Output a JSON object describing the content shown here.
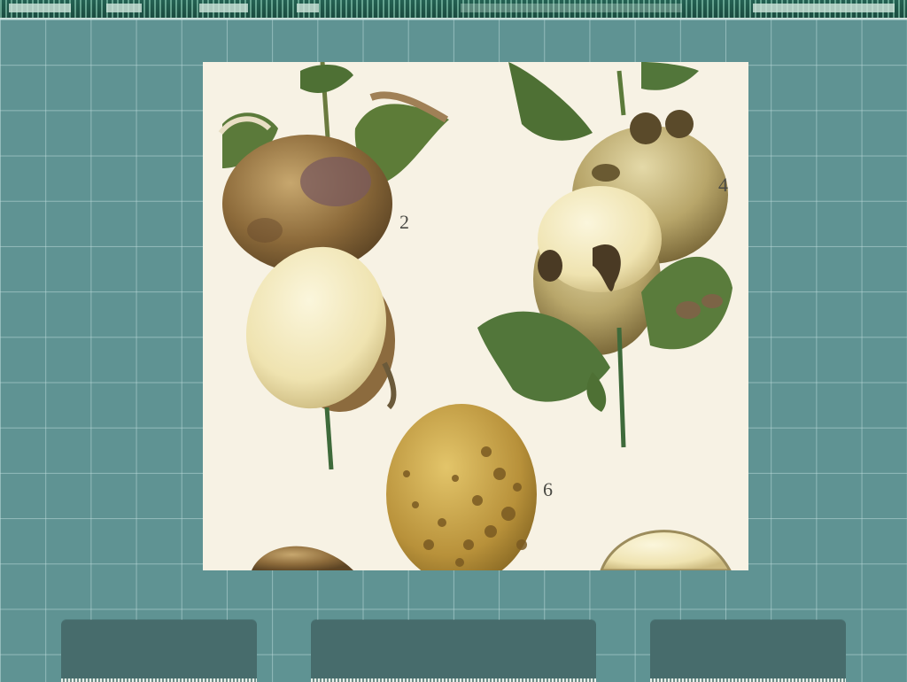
{
  "figure": {
    "label_2": "2",
    "label_4": "4",
    "label_6": "6"
  },
  "nav": {
    "buttons": [
      "",
      "",
      ""
    ]
  },
  "colors": {
    "background": "#5f9393",
    "tab": "#476c6c",
    "paper": "#f7f2e4"
  }
}
